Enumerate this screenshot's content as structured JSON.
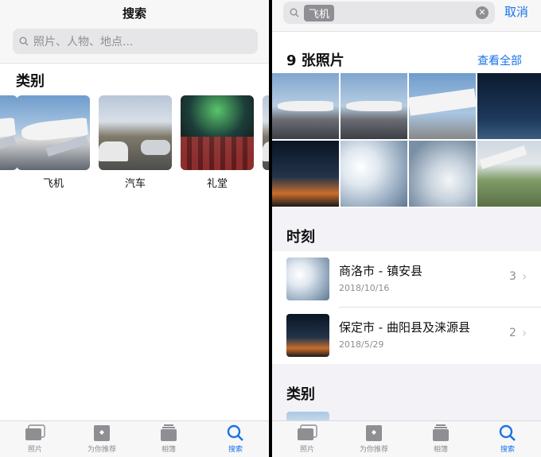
{
  "left": {
    "title": "搜索",
    "search": {
      "placeholder": "照片、人物、地点..."
    },
    "section_title": "类别",
    "categories": [
      {
        "label": "飞机",
        "icon": "airplane-photo"
      },
      {
        "label": "汽车",
        "icon": "car-photo"
      },
      {
        "label": "礼堂",
        "icon": "auditorium-photo"
      }
    ]
  },
  "right": {
    "search": {
      "token": "飞机",
      "cancel_label": "取消"
    },
    "photos_title": "9 张照片",
    "see_all_label": "查看全部",
    "moments_title": "时刻",
    "moments": [
      {
        "title": "商洛市 - 镇安县",
        "date": "2018/10/16",
        "count": "3"
      },
      {
        "title": "保定市 - 曲阳县及涞源县",
        "date": "2018/5/29",
        "count": "2"
      }
    ],
    "categories_title": "类别"
  },
  "tabbar": {
    "tabs": [
      {
        "label": "照片",
        "icon": "photos-icon"
      },
      {
        "label": "为你推荐",
        "icon": "for-you-icon"
      },
      {
        "label": "相簿",
        "icon": "albums-icon"
      },
      {
        "label": "搜索",
        "icon": "search-icon",
        "active": true
      }
    ]
  },
  "colors": {
    "accent": "#1a73e8",
    "secondary_text": "#8e8e93"
  }
}
